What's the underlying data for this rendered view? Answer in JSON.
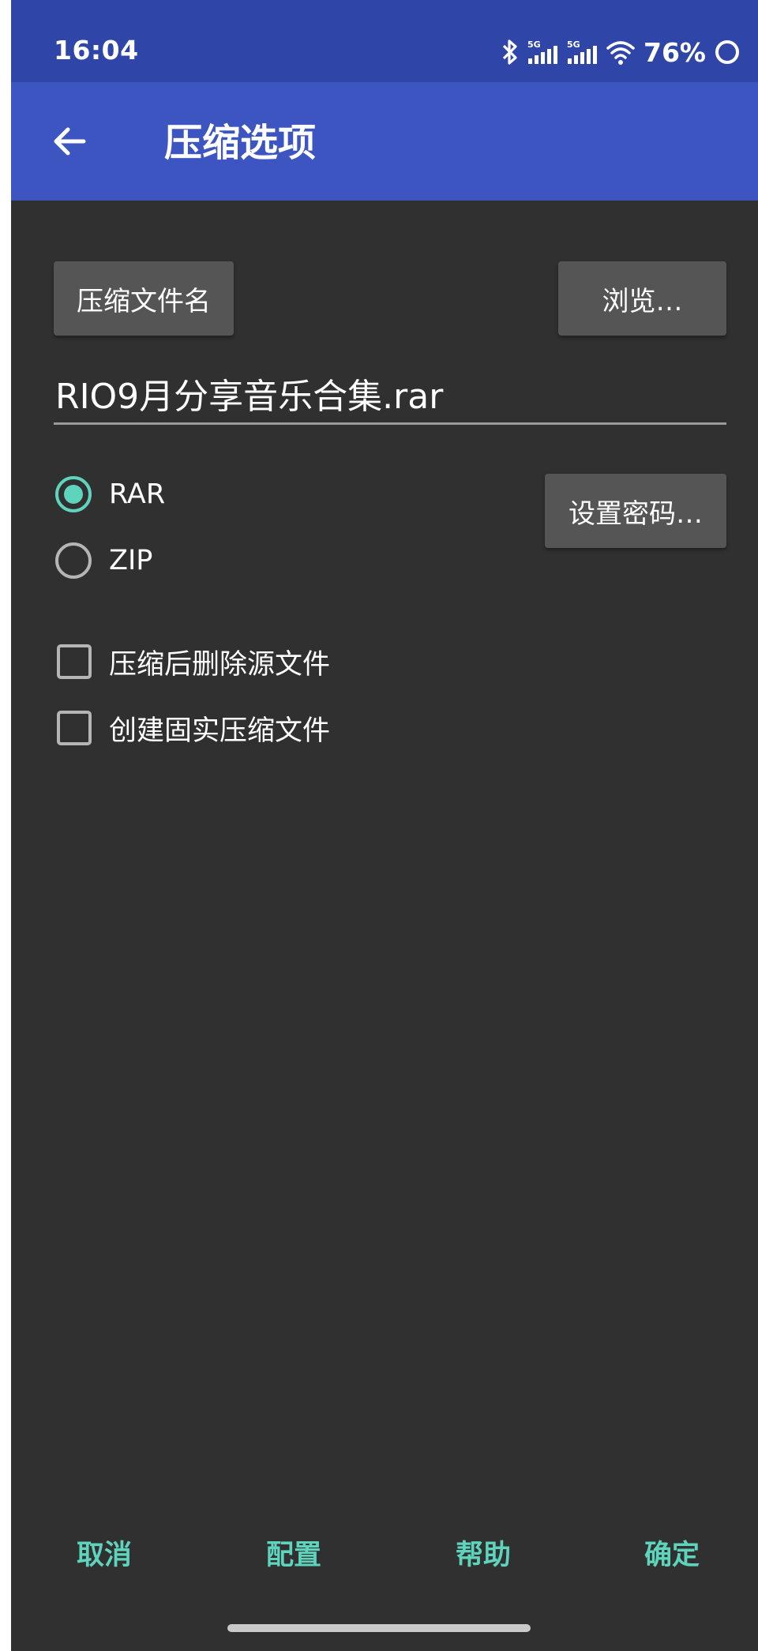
{
  "status_bar": {
    "time": "16:04",
    "battery_percent": "76%",
    "icons": [
      "bluetooth-icon",
      "signal-5g-icon",
      "signal-5g-icon",
      "wifi-icon",
      "battery-ring-icon"
    ],
    "signal_label": "5G"
  },
  "app_bar": {
    "title": "压缩选项",
    "back_icon": "arrow-left-icon"
  },
  "form": {
    "archive_name_button": "压缩文件名",
    "browse_button": "浏览…",
    "filename_value": "RIO9月分享音乐合集.rar",
    "formats": [
      {
        "label": "RAR",
        "selected": true
      },
      {
        "label": "ZIP",
        "selected": false
      }
    ],
    "set_password_button": "设置密码…",
    "options": [
      {
        "label": "压缩后删除源文件",
        "checked": false
      },
      {
        "label": "创建固实压缩文件",
        "checked": false
      }
    ]
  },
  "footer": {
    "cancel": "取消",
    "config": "配置",
    "help": "帮助",
    "ok": "确定"
  },
  "colors": {
    "status_bar_bg": "#2f46a8",
    "app_bar_bg": "#3d55c1",
    "background": "#303030",
    "accent": "#5ed4bd",
    "button_bg": "#555555"
  }
}
